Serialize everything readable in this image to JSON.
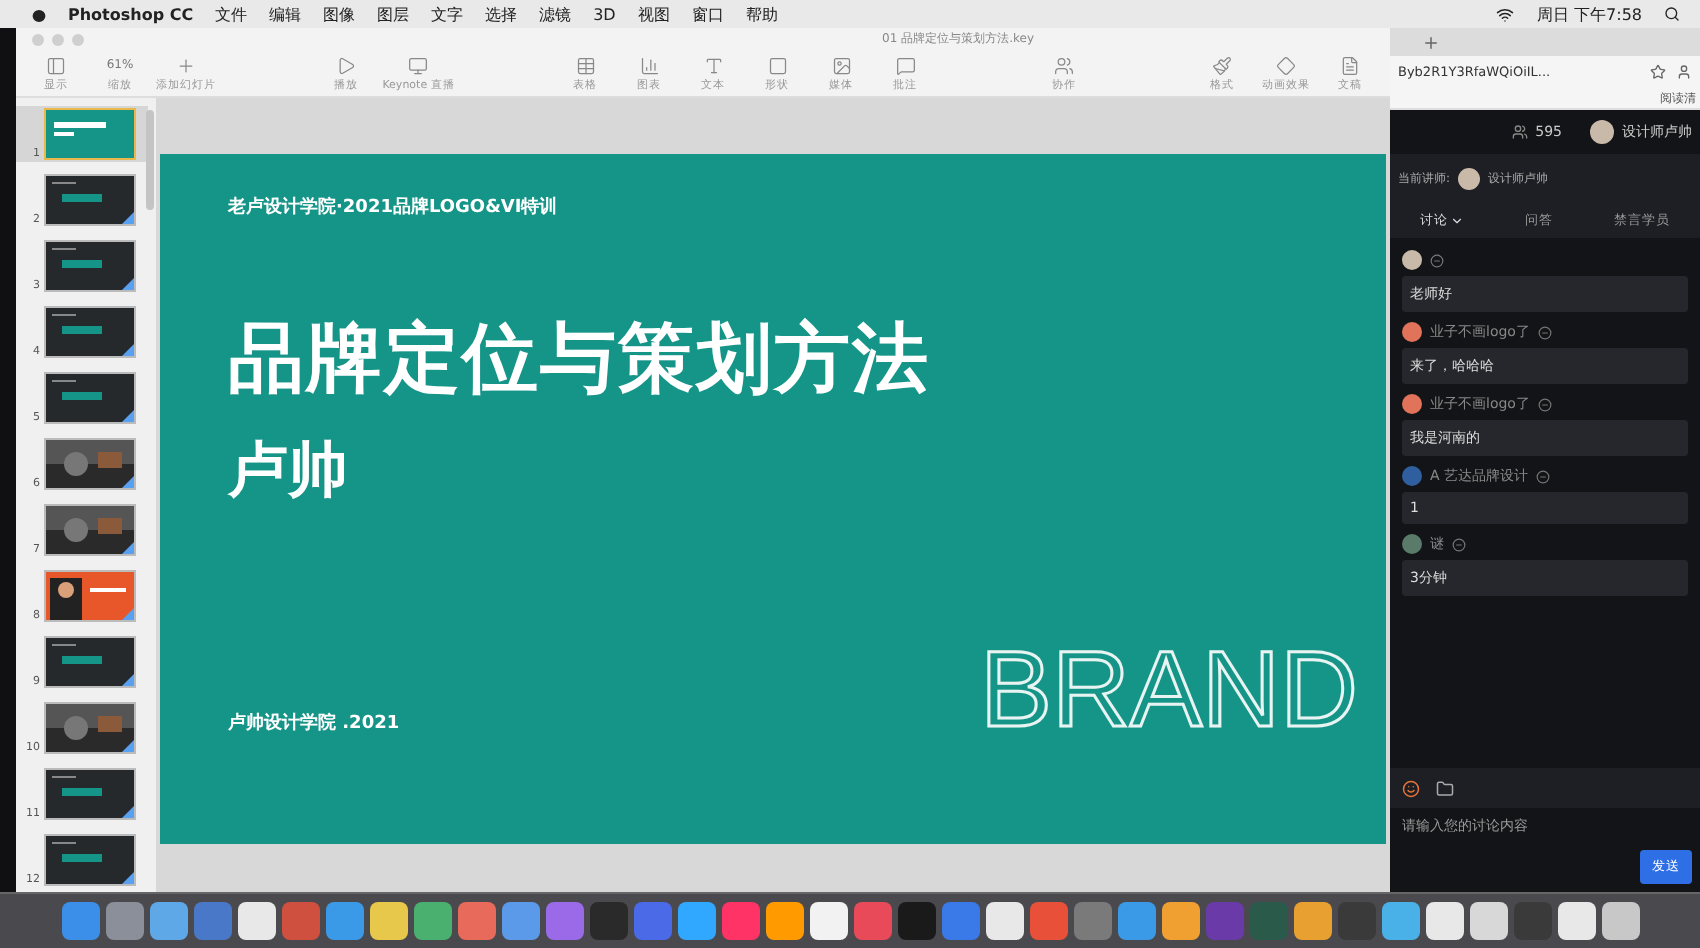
{
  "menubar": {
    "app": "Photoshop CC",
    "menus": [
      "文件",
      "编辑",
      "图像",
      "图层",
      "文字",
      "选择",
      "滤镜",
      "3D",
      "视图",
      "窗口",
      "帮助"
    ],
    "clock": "周日 下午7:58"
  },
  "keynote": {
    "title": "01 品牌定位与策划方法.key",
    "tools": [
      {
        "kind": "view",
        "label": "显示"
      },
      {
        "kind": "zoom",
        "label": "缩放",
        "value": "61%"
      },
      {
        "kind": "add",
        "label": "添加幻灯片"
      },
      {
        "kind": "gap"
      },
      {
        "kind": "play",
        "label": "播放"
      },
      {
        "kind": "live",
        "label": "Keynote 直播"
      },
      {
        "kind": "gap"
      },
      {
        "kind": "table",
        "label": "表格"
      },
      {
        "kind": "chart",
        "label": "图表"
      },
      {
        "kind": "text",
        "label": "文本"
      },
      {
        "kind": "shape",
        "label": "形状"
      },
      {
        "kind": "media",
        "label": "媒体"
      },
      {
        "kind": "comment",
        "label": "批注"
      },
      {
        "kind": "gap"
      },
      {
        "kind": "collaborate",
        "label": "协作"
      },
      {
        "kind": "gap"
      },
      {
        "kind": "format",
        "label": "格式"
      },
      {
        "kind": "animate",
        "label": "动画效果"
      },
      {
        "kind": "document",
        "label": "文稿"
      }
    ],
    "slides": [
      {
        "number": "1",
        "kind": "title",
        "selected": true
      },
      {
        "number": "2",
        "kind": "dark",
        "selected": false
      },
      {
        "number": "3",
        "kind": "dark",
        "selected": false
      },
      {
        "number": "4",
        "kind": "dark",
        "selected": false
      },
      {
        "number": "5",
        "kind": "dark",
        "selected": false
      },
      {
        "number": "6",
        "kind": "photo",
        "selected": false
      },
      {
        "number": "7",
        "kind": "photo",
        "selected": false
      },
      {
        "number": "8",
        "kind": "orange",
        "selected": false
      },
      {
        "number": "9",
        "kind": "dark",
        "selected": false
      },
      {
        "number": "10",
        "kind": "photo",
        "selected": false
      },
      {
        "number": "11",
        "kind": "dark",
        "selected": false
      },
      {
        "number": "12",
        "kind": "dark",
        "selected": false
      }
    ],
    "slide": {
      "header": "老卢设计学院·2021品牌LOGO&VI特训",
      "title": "品牌定位与策划方法",
      "author": "卢帅",
      "footer": "卢帅设计学院 .2021",
      "word": "BRAND"
    }
  },
  "browser": {
    "url": "Byb2R1Y3RfaWQiOiIL...",
    "reading_list": "阅读清"
  },
  "chat": {
    "viewers": "595",
    "host": "设计师卢帅",
    "lecturer_label": "当前讲师:",
    "lecturer": "设计师卢帅",
    "tabs": [
      {
        "label": "讨论",
        "selected": true
      },
      {
        "label": "问答",
        "selected": false
      },
      {
        "label": "禁言学员",
        "selected": false
      }
    ],
    "messages": [
      {
        "text": "老师好",
        "color": "#c9b9a8"
      },
      {
        "name": "业子不画logo了",
        "text": "来了，哈哈哈",
        "color": "#e0735a"
      },
      {
        "name": "业子不画logo了",
        "text": "我是河南的",
        "color": "#e0735a"
      },
      {
        "name": "A 艺达品牌设计",
        "text": "1",
        "color": "#2f5f9e"
      },
      {
        "name": "谜",
        "text": "3分钟",
        "color": "#5a7a6a"
      }
    ],
    "placeholder": "请输入您的讨论内容",
    "send": "发送"
  },
  "dock": [
    {
      "color": "#3b8fe8"
    },
    {
      "color": "#8a8f99"
    },
    {
      "color": "#5fa8e8"
    },
    {
      "color": "#4a78c8"
    },
    {
      "color": "#e8e8e8"
    },
    {
      "color": "#d05040"
    },
    {
      "color": "#3a9ae8"
    },
    {
      "color": "#e8c84a"
    },
    {
      "color": "#4ab070"
    },
    {
      "color": "#e86a5a"
    },
    {
      "color": "#5a9ae8"
    },
    {
      "color": "#9a6ae8"
    },
    {
      "color": "#2a2a2a"
    },
    {
      "color": "#4a6ae8"
    },
    {
      "color": "#31a8ff"
    },
    {
      "color": "#ff3366"
    },
    {
      "color": "#ff9a00"
    },
    {
      "color": "#f2f2f2"
    },
    {
      "color": "#e84a5a"
    },
    {
      "color": "#1a1a1a"
    },
    {
      "color": "#3a7ae8"
    },
    {
      "color": "#e8e8e8"
    },
    {
      "color": "#e8503a"
    },
    {
      "color": "#7a7a7a"
    },
    {
      "color": "#3a9ae8"
    },
    {
      "color": "#f0a030"
    },
    {
      "color": "#6a3aa8"
    },
    {
      "color": "#2a5a4a"
    },
    {
      "color": "#e8a030"
    },
    {
      "color": "#3a3a3a"
    },
    {
      "color": "#4ab0e8"
    },
    {
      "color": "#e8e8e8"
    },
    {
      "color": "#d8d8d8"
    },
    {
      "color": "#3a3a3a"
    },
    {
      "color": "#e8e8e8"
    },
    {
      "color": "#c8c8c8"
    }
  ]
}
